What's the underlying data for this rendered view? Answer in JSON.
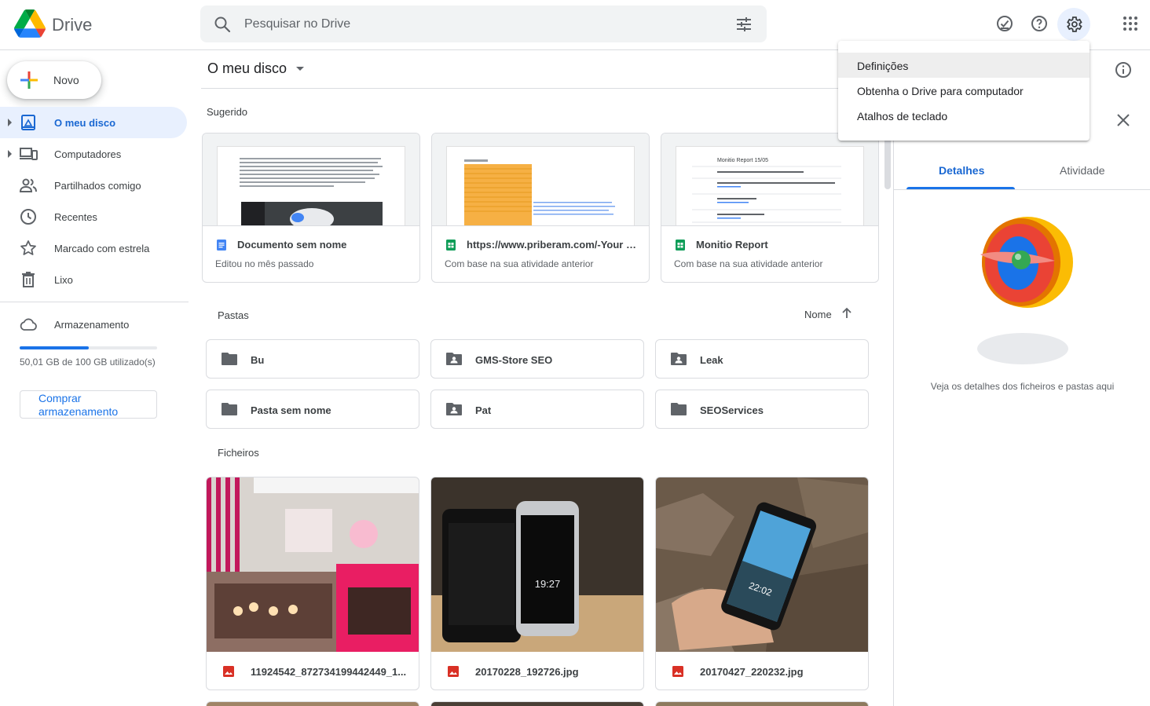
{
  "header": {
    "app_name": "Drive",
    "search_placeholder": "Pesquisar no Drive"
  },
  "sidebar": {
    "new_label": "Novo",
    "items": [
      {
        "label": "O meu disco",
        "icon": "my-drive-icon",
        "active": true
      },
      {
        "label": "Computadores",
        "icon": "computers-icon"
      },
      {
        "label": "Partilhados comigo",
        "icon": "shared-icon"
      },
      {
        "label": "Recentes",
        "icon": "clock-icon"
      },
      {
        "label": "Marcado com estrela",
        "icon": "star-icon"
      },
      {
        "label": "Lixo",
        "icon": "trash-icon"
      }
    ],
    "storage": {
      "label": "Armazenamento",
      "usage_text": "50,01 GB de 100 GB utilizado(s)",
      "used_fraction": 0.5001,
      "buy_label": "Comprar armazenamento"
    }
  },
  "main": {
    "breadcrumb": "O meu disco",
    "suggested_title": "Sugerido",
    "suggested": [
      {
        "name": "Documento sem nome",
        "meta": "Editou no mês passado",
        "type": "doc"
      },
      {
        "name": "https://www.priberam.com/-Your p...",
        "meta": "Com base na sua atividade anterior",
        "type": "sheet"
      },
      {
        "name": "Monitio Report",
        "meta": "Com base na sua atividade anterior",
        "type": "sheet",
        "preview_title": "Monitio Report 15/05"
      }
    ],
    "folders_title": "Pastas",
    "sort_label": "Nome",
    "folders": [
      {
        "name": "Bu",
        "shared": false
      },
      {
        "name": "GMS-Store SEO",
        "shared": true
      },
      {
        "name": "Leak",
        "shared": true
      },
      {
        "name": "Pasta sem nome",
        "shared": false
      },
      {
        "name": "Pat",
        "shared": true
      },
      {
        "name": "SEOServices",
        "shared": false
      }
    ],
    "files_title": "Ficheiros",
    "files": [
      {
        "name": "11924542_872734199442449_1..."
      },
      {
        "name": "20170228_192726.jpg",
        "phone_time": "19:27"
      },
      {
        "name": "20170427_220232.jpg",
        "phone_time": "22:02"
      }
    ]
  },
  "details_panel": {
    "tabs": [
      "Detalhes",
      "Atividade"
    ],
    "empty_text": "Veja os detalhes dos ficheiros e pastas aqui"
  },
  "settings_menu": {
    "items": [
      "Definições",
      "Obtenha o Drive para computador",
      "Atalhos de teclado"
    ]
  },
  "colors": {
    "accent": "#1a73e8",
    "active_bg": "#e8f0fe",
    "doc_blue": "#4285f4",
    "sheet_green": "#0f9d58",
    "image_red": "#d93025"
  }
}
